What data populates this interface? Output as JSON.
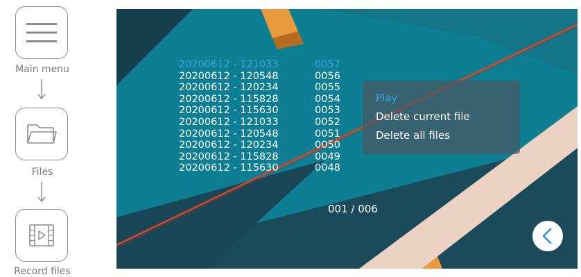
{
  "nav": {
    "main_menu_label": "Main menu",
    "files_label": "Files",
    "record_files_label": "Record files"
  },
  "files": [
    {
      "name": "20200612 - 121033",
      "number": "0057",
      "selected": true
    },
    {
      "name": "20200612 - 120548",
      "number": "0056"
    },
    {
      "name": "20200612 - 120234",
      "number": "0055"
    },
    {
      "name": "20200612 - 115828",
      "number": "0054"
    },
    {
      "name": "20200612 - 115630",
      "number": "0053"
    },
    {
      "name": "20200612 - 121033",
      "number": "0052"
    },
    {
      "name": "20200612 - 120548",
      "number": "0051"
    },
    {
      "name": "20200612 - 120234",
      "number": "0050"
    },
    {
      "name": "20200612 - 115828",
      "number": "0049"
    },
    {
      "name": "20200612 - 115630",
      "number": "0048"
    }
  ],
  "context_menu": {
    "play": "Play",
    "delete_current": "Delete current file",
    "delete_all": "Delete all files"
  },
  "page_indicator": "001 / 006",
  "icons": {
    "main_menu": "hamburger-icon",
    "files": "folder-icon",
    "record_files": "video-file-icon",
    "back": "chevron-left-icon"
  },
  "colors": {
    "selected": "#3aa3e4",
    "background_teal": "#0e7f92",
    "background_dark": "#1b4a5b",
    "stripe_orange": "#e89a3c",
    "stripe_red": "#c9452d",
    "stripe_beige": "#ecd2c3"
  }
}
